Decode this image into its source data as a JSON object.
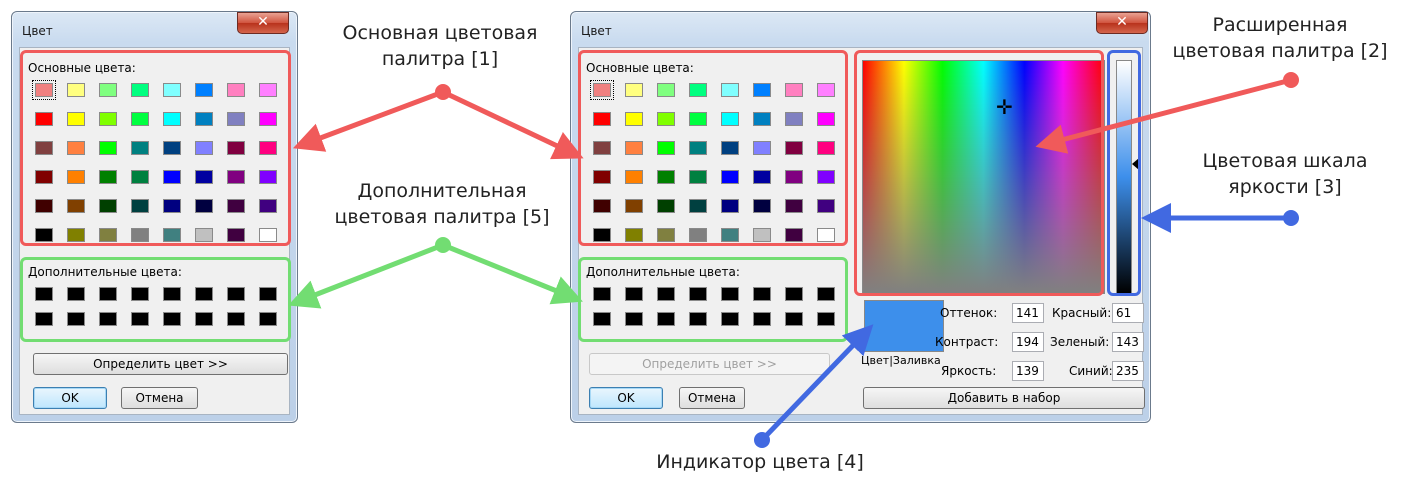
{
  "colors": {
    "annotation_red": "#f05a5a",
    "annotation_green": "#72dd72",
    "annotation_blue": "#4169e1",
    "indicator_color": "#3d8feb"
  },
  "left_dialog": {
    "title": "Цвет",
    "close_icon": "close-icon",
    "basic_label": "Основные цвета:",
    "custom_label": "Дополнительные цвета:",
    "define_button": "Определить цвет >>",
    "ok_button": "OK",
    "cancel_button": "Отмена"
  },
  "right_dialog": {
    "title": "Цвет",
    "close_icon": "close-icon",
    "basic_label": "Основные цвета:",
    "custom_label": "Дополнительные цвета:",
    "define_button": "Определить цвет >>",
    "ok_button": "OK",
    "cancel_button": "Отмена",
    "indicator_label": "Цвет|Заливка",
    "add_button": "Добавить в набор",
    "fields": {
      "hue_label": "Оттенок:",
      "hue_value": "141",
      "sat_label": "Контраст:",
      "sat_value": "194",
      "lum_label": "Яркость:",
      "lum_value": "139",
      "red_label": "Красный:",
      "red_value": "61",
      "green_label": "Зеленый:",
      "green_value": "143",
      "blue_label": "Синий:",
      "blue_value": "235"
    }
  },
  "basic_colors": [
    [
      "#f08080",
      "#ffff80",
      "#80ff80",
      "#00ff80",
      "#80ffff",
      "#0080ff",
      "#ff80c0",
      "#ff80ff"
    ],
    [
      "#ff0000",
      "#ffff00",
      "#80ff00",
      "#00ff40",
      "#00ffff",
      "#0080c0",
      "#8080c0",
      "#ff00ff"
    ],
    [
      "#804040",
      "#ff8040",
      "#00ff00",
      "#008080",
      "#004080",
      "#8080ff",
      "#800040",
      "#ff0080"
    ],
    [
      "#800000",
      "#ff8000",
      "#008000",
      "#008040",
      "#0000ff",
      "#0000a0",
      "#800080",
      "#8000ff"
    ],
    [
      "#400000",
      "#804000",
      "#004000",
      "#004040",
      "#000080",
      "#000040",
      "#400040",
      "#400080"
    ],
    [
      "#000000",
      "#808000",
      "#808040",
      "#808080",
      "#408080",
      "#c0c0c0",
      "#400040",
      "#ffffff"
    ]
  ],
  "custom_colors": [
    [
      "#000000",
      "#000000",
      "#000000",
      "#000000",
      "#000000",
      "#000000",
      "#000000",
      "#000000"
    ],
    [
      "#000000",
      "#000000",
      "#000000",
      "#000000",
      "#000000",
      "#000000",
      "#000000",
      "#000000"
    ]
  ],
  "annotations": {
    "basic_palette": "Основная цветовая\nпалитра [1]",
    "custom_palette": "Дополнительная\nцветовая палитра [5]",
    "extended_palette": "Расширенная\nцветовая палитра [2]",
    "luminance_scale": "Цветовая шкала\nяркости [3]",
    "color_indicator": "Индикатор цвета [4]"
  }
}
